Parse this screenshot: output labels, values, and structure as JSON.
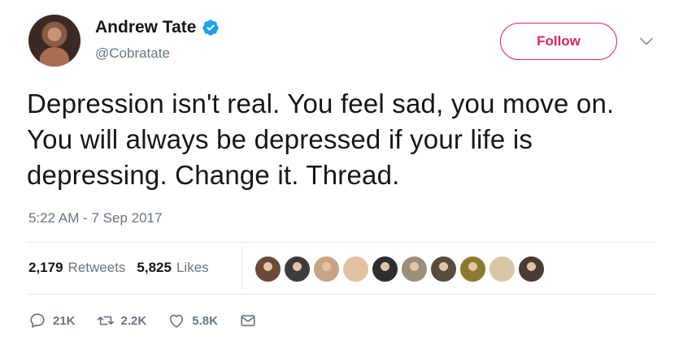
{
  "user": {
    "display_name": "Andrew Tate",
    "handle": "@Cobratate",
    "verified": true
  },
  "follow_label": "Follow",
  "tweet": {
    "text": "Depression isn't real. You feel sad, you move on. You will always be depressed if your life is depressing. Change it. Thread.",
    "timestamp": "5:22 AM - 7 Sep 2017"
  },
  "stats": {
    "retweets_count": "2,179",
    "retweets_label": "Retweets",
    "likes_count": "5,825",
    "likes_label": "Likes"
  },
  "likers": [
    {
      "color": "#6b4a3a"
    },
    {
      "color": "#3c3c3c"
    },
    {
      "color": "#c7a482"
    },
    {
      "color": "#e2c2a3"
    },
    {
      "color": "#2e2e2e"
    },
    {
      "color": "#9a8f78"
    },
    {
      "color": "#5a4b3d"
    },
    {
      "color": "#8a7a2e"
    },
    {
      "color": "#d9c6a8"
    },
    {
      "color": "#4a3b34"
    }
  ],
  "actions": {
    "reply_count": "21K",
    "retweet_count": "2.2K",
    "like_count": "5.8K"
  },
  "colors": {
    "accent": "#e0245e",
    "verified_blue": "#1da1f2",
    "secondary_text": "#657786"
  }
}
